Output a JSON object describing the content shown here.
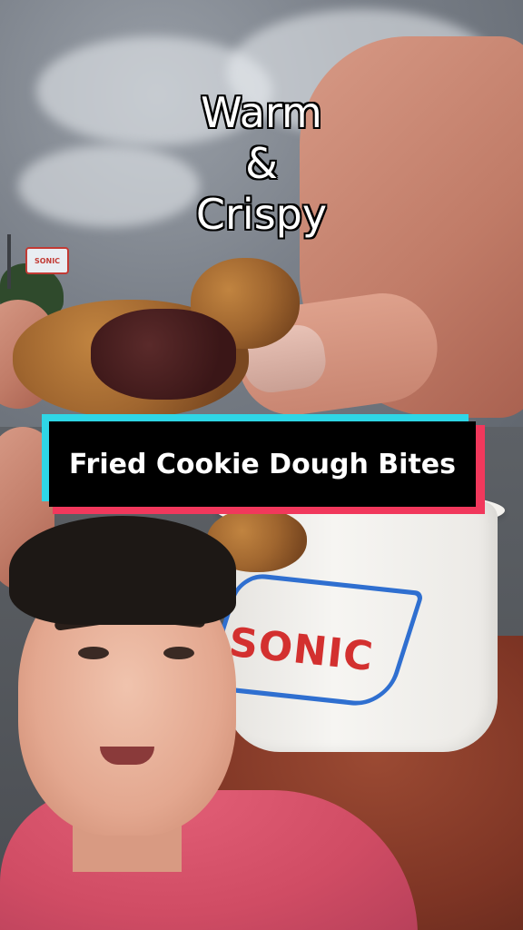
{
  "overlay": {
    "caption_lines": [
      "Warm",
      "&",
      "Crispy"
    ],
    "title": "Fried Cookie Dough Bites"
  },
  "scene": {
    "cup_logo": "SONIC",
    "street_sign": "SONIC"
  },
  "colors": {
    "title_bg": "#000000",
    "title_text": "#ffffff",
    "accent_cyan": "#2fd6e6",
    "accent_red": "#f1385c",
    "shirt": "#d04c64",
    "logo_red": "#d3302f",
    "logo_blue": "#2f6fd0"
  }
}
